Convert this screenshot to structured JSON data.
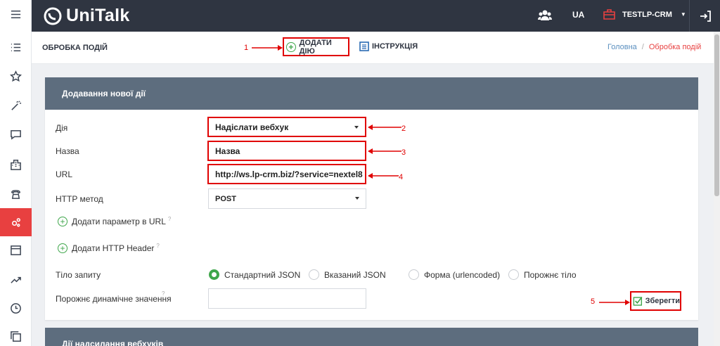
{
  "brand": {
    "name": "UniTalk"
  },
  "topbar": {
    "lang": "UA",
    "account": "TESTLP-CRM"
  },
  "page": {
    "title": "ОБРОБКА ПОДІЙ",
    "add_action": "ДОДАТИ ДІЮ",
    "instruction": "ІНСТРУКЦІЯ"
  },
  "breadcrumb": {
    "home": "Головна",
    "sep": "/",
    "current": "Обробка подій"
  },
  "annotations": {
    "n1": "1",
    "n2": "2",
    "n3": "3",
    "n4": "4",
    "n5": "5",
    "color": "#e00000"
  },
  "form": {
    "heading": "Додавання нової дії",
    "action_label": "Дія",
    "action_value": "Надіслати вебхук",
    "name_label": "Назва",
    "name_value": "Назва",
    "url_label": "URL",
    "url_value": "http://ws.lp-crm.biz/?service=nextel8",
    "method_label": "HTTP метод",
    "method_value": "POST",
    "add_url_param": "Додати параметр в URL",
    "add_header": "Додати HTTP Header",
    "body_label": "Тіло запиту",
    "body_options": [
      "Стандартний JSON",
      "Вказаний JSON",
      "Форма (urlencoded)",
      "Порожнє тіло"
    ],
    "body_selected": "Стандартний JSON",
    "empty_value_label": "Порожнє динамічне значення",
    "empty_value": "",
    "save": "Зберегти"
  },
  "next_section": {
    "heading": "Дії надсилання вебхуків"
  },
  "colors": {
    "topbar": "#2f3541",
    "accent_red": "#e84040",
    "green": "#3fa64b",
    "panel_head": "#5d6d7e",
    "link": "#5a8fbf"
  }
}
